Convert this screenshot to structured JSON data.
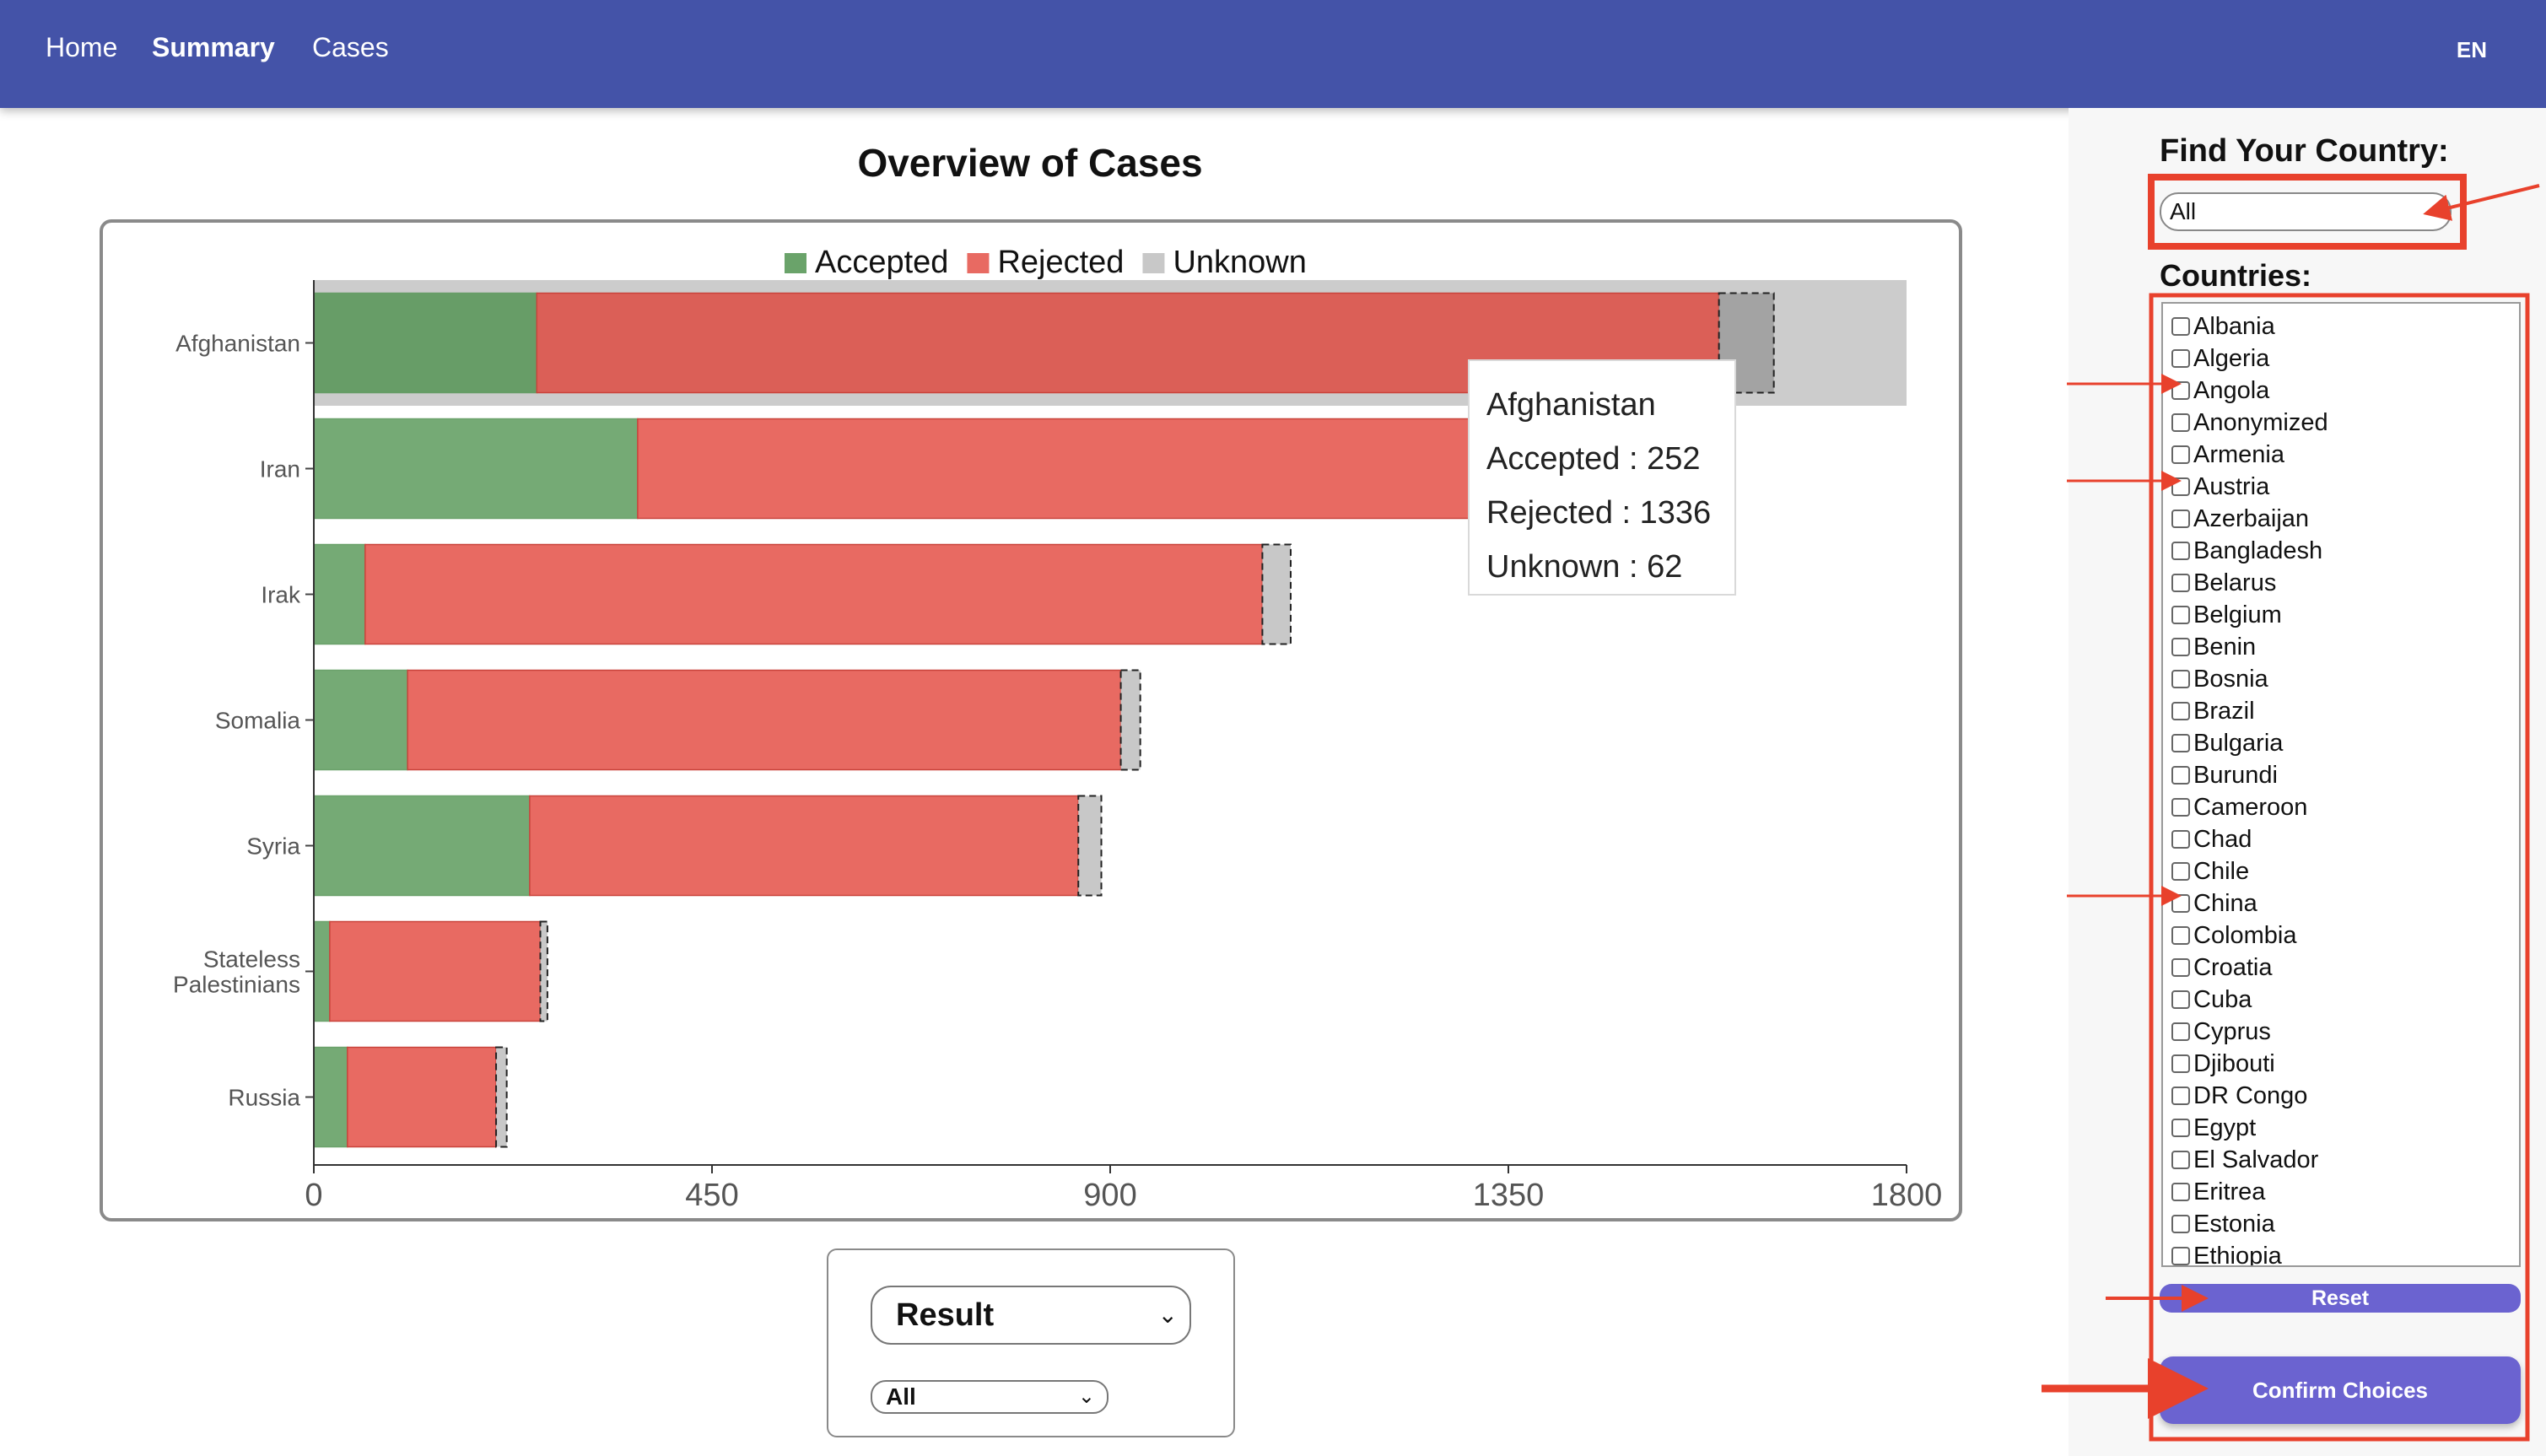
{
  "nav": {
    "items": [
      {
        "label": "Home",
        "active": false
      },
      {
        "label": "Summary",
        "active": true
      },
      {
        "label": "Cases",
        "active": false
      }
    ],
    "language": "EN"
  },
  "page_title": "Overview of Cases",
  "chart_data": {
    "type": "bar",
    "orientation": "horizontal",
    "stacked": true,
    "categories": [
      "Afghanistan",
      "Iran",
      "Irak",
      "Somalia",
      "Syria",
      "Stateless Palestinians",
      "Russia"
    ],
    "series": [
      {
        "name": "Accepted",
        "color": "#6aa36a",
        "values": [
          252,
          366,
          58,
          106,
          244,
          18,
          38
        ]
      },
      {
        "name": "Rejected",
        "color": "#e86a62",
        "values": [
          1336,
          948,
          1014,
          806,
          620,
          238,
          168
        ]
      },
      {
        "name": "Unknown",
        "color": "#c8c8c8",
        "values": [
          62,
          38,
          32,
          22,
          26,
          8,
          12
        ]
      }
    ],
    "xlim": [
      0,
      1800
    ],
    "xticks": [
      "0",
      "450",
      "900",
      "1350",
      "1800"
    ],
    "legend_position": "top",
    "highlighted_category": "Afghanistan",
    "grid": false
  },
  "tooltip": {
    "country": "Afghanistan",
    "accepted": "Accepted : 252",
    "rejected": "Rejected : 1336",
    "unknown": "Unknown : 62"
  },
  "bottom_controls": {
    "primary_select": "Result",
    "secondary_select": "All"
  },
  "sidebar": {
    "find_title": "Find Your Country:",
    "country_select_value": "All",
    "countries_title": "Countries:",
    "countries": [
      "Albania",
      "Algeria",
      "Angola",
      "Anonymized",
      "Armenia",
      "Austria",
      "Azerbaijan",
      "Bangladesh",
      "Belarus",
      "Belgium",
      "Benin",
      "Bosnia",
      "Brazil",
      "Bulgaria",
      "Burundi",
      "Cameroon",
      "Chad",
      "Chile",
      "China",
      "Colombia",
      "Croatia",
      "Cuba",
      "Cyprus",
      "Djibouti",
      "DR Congo",
      "Egypt",
      "El Salvador",
      "Eritrea",
      "Estonia",
      "Ethiopia"
    ],
    "reset_label": "Reset",
    "confirm_label": "Confirm Choices"
  },
  "colors": {
    "nav_bg": "#4453a8",
    "button_bg": "#6b63d0",
    "annotation": "#e8412c"
  }
}
